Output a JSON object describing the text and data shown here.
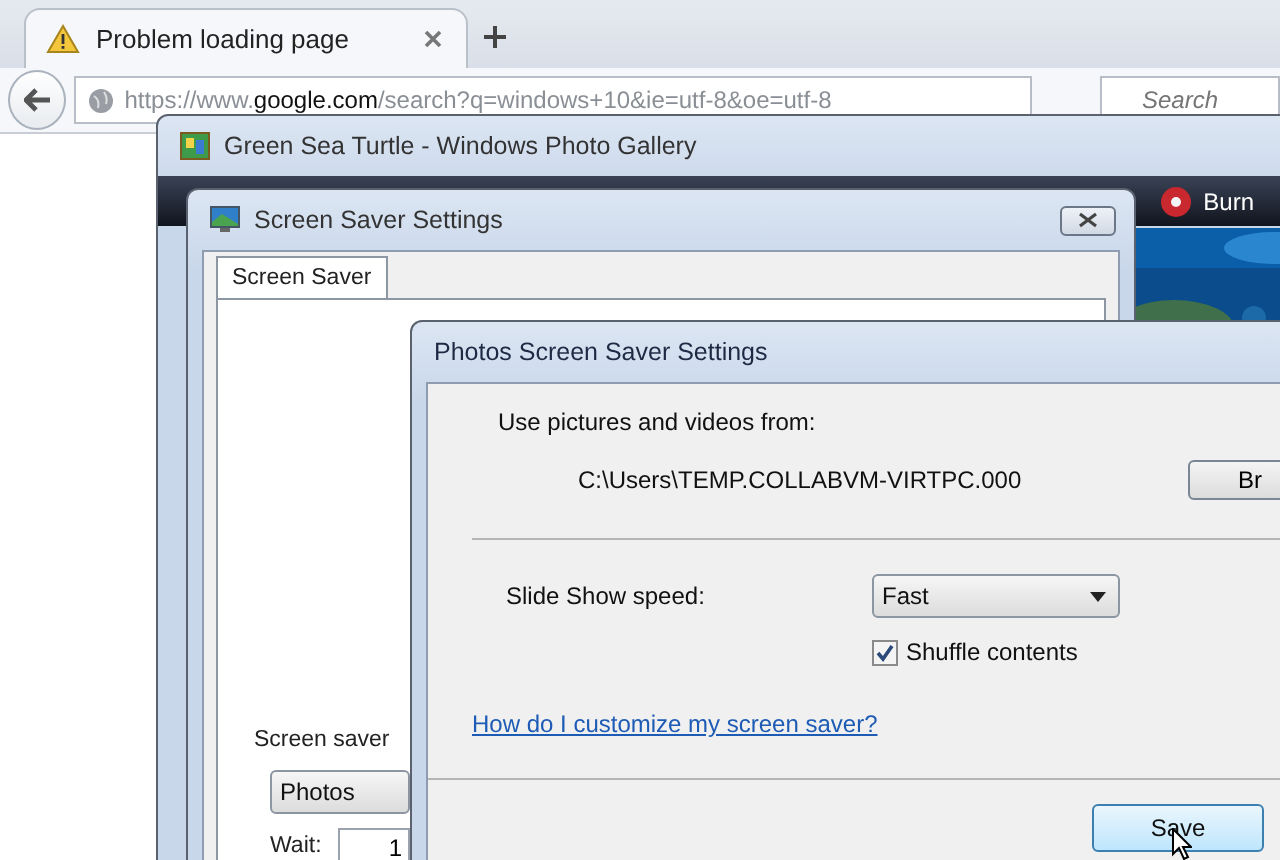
{
  "browser": {
    "tabs": [
      {
        "title": "Problem loading page",
        "selected": true
      }
    ],
    "address": "https://www.**google.com**/search?q=windows+10&ie=utf-8&oe=utf-8",
    "search": {
      "placeholder": "Search"
    }
  },
  "gallery_window": {
    "title": "Green Sea Turtle - Windows Photo Gallery",
    "toolbar": [
      {
        "label": "Burn"
      }
    ]
  },
  "screen_saver_window": {
    "title": "Screen Saver Settings",
    "tabs": [
      {
        "label": "Screen Saver",
        "selected": true
      }
    ],
    "group": {
      "label": "Screen saver",
      "select": "Photos",
      "wait_label": "Wait:",
      "wait_value": "1"
    }
  },
  "photos_dialog": {
    "title": "Photos Screen Saver Settings",
    "source_label": "Use pictures and videos from:",
    "source_path": "C:\\Users\\TEMP.COLLABVM-VIRTPC.000",
    "browse_button": "Br",
    "speed_label": "Slide Show speed:",
    "speed_value": "Fast",
    "shuffle": {
      "label": "Shuffle contents",
      "checked": true
    },
    "help_link": "How do I customize my screen saver?",
    "buttons": [
      "Save"
    ]
  }
}
